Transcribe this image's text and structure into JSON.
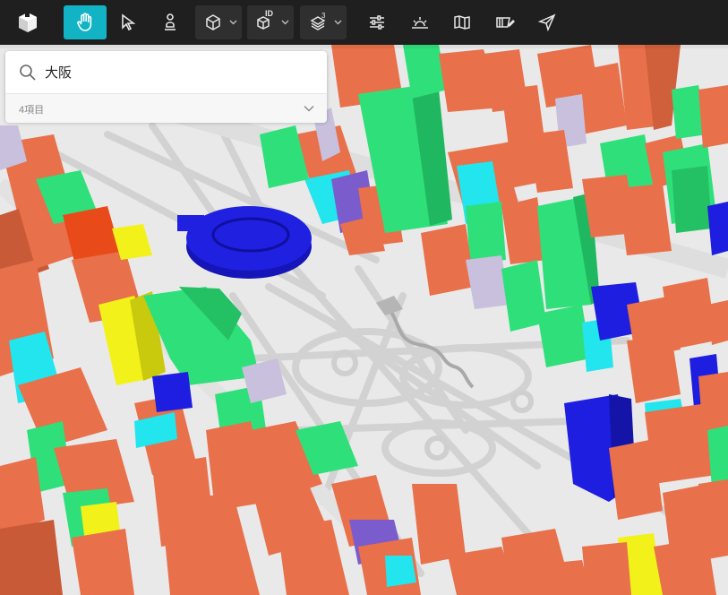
{
  "app": {
    "logo": "cube-logo-icon",
    "accent_color": "#12b3c4"
  },
  "toolbar": {
    "tools": [
      {
        "name": "pan",
        "icon": "hand-icon",
        "active": true
      },
      {
        "name": "select",
        "icon": "cursor-arrow-icon"
      },
      {
        "name": "pedestrian",
        "icon": "pedestrian-icon"
      },
      {
        "name": "display-mode",
        "icon": "cube-icon",
        "dropdown": true
      },
      {
        "name": "id",
        "icon": "cube-id-icon",
        "label": "ID",
        "dropdown": true
      },
      {
        "name": "layers",
        "icon": "layers-icon",
        "label": "3",
        "dropdown": true
      },
      {
        "name": "settings",
        "icon": "sliders-icon"
      },
      {
        "name": "sun",
        "icon": "sunrise-icon"
      },
      {
        "name": "map",
        "icon": "folded-map-icon"
      },
      {
        "name": "edit",
        "icon": "eraser-edit-icon"
      },
      {
        "name": "share",
        "icon": "send-arrow-icon"
      }
    ]
  },
  "search": {
    "value": "大阪",
    "icon": "search-icon",
    "result_count": "4項目",
    "expand_icon": "chevron-down-icon"
  },
  "map_colors": {
    "building_orange": "#e8704a",
    "building_green": "#2fe07a",
    "building_blue": "#1e1ee0",
    "building_cyan": "#22e5ee",
    "building_yellow": "#f2f21a",
    "building_purple": "#7a5ccd",
    "building_lilac": "#c8c0dc",
    "ground": "#e9e9e9",
    "road": "#d0d0d0"
  }
}
